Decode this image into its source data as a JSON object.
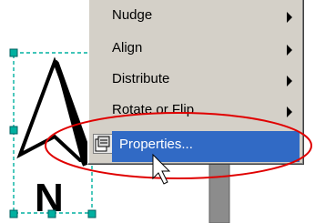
{
  "context_menu": {
    "items": [
      {
        "label": "Nudge",
        "has_submenu": true
      },
      {
        "label": "Align",
        "has_submenu": true
      },
      {
        "label": "Distribute",
        "has_submenu": true
      },
      {
        "label": "Rotate or Flip",
        "has_submenu": true
      },
      {
        "label": "Properties...",
        "has_submenu": false,
        "highlighted": true,
        "icon": "properties-icon"
      }
    ]
  },
  "shape": {
    "text": "N"
  },
  "colors": {
    "menu_bg": "#d4d0c8",
    "highlight": "#316ac5",
    "selection_handle": "#00b0a0",
    "annotation": "#e00000"
  }
}
